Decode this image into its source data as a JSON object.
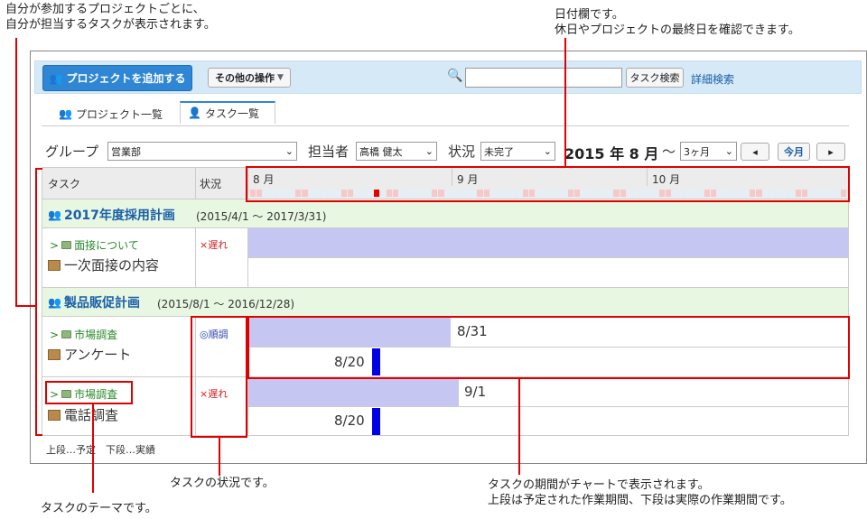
{
  "annotations": {
    "top_left_line1": "自分が参加するプロジェクトごとに、",
    "top_left_line2": "自分が担当するタスクが表示されます。",
    "top_right_line1": "日付欄です。",
    "top_right_line2": "休日やプロジェクトの最終日を確認できます。",
    "status_note": "タスクの状況です。",
    "theme_note": "タスクのテーマです。",
    "chart_note_line1": "タスクの期間がチャートで表示されます。",
    "chart_note_line2": "上段は予定された作業期間、下段は実際の作業期間です。"
  },
  "toolbar": {
    "add_project": "プロジェクトを追加する",
    "other_ops": "その他の操作",
    "search_value": "",
    "task_search": "タスク検索",
    "advanced_search": "詳細検索"
  },
  "tabs": [
    {
      "label": "プロジェクト一覧"
    },
    {
      "label": "タスク一覧"
    }
  ],
  "filters": {
    "group_label": "グループ",
    "group_value": "営業部",
    "assignee_label": "担当者",
    "assignee_value": "高橋 健太",
    "status_label": "状況",
    "status_value": "未完了",
    "date_display": "2015 年 8 月",
    "tilde": "～",
    "range_value": "3ヶ月",
    "prev": "◂",
    "today": "今月",
    "next": "▸"
  },
  "table": {
    "col_task": "タスク",
    "col_status": "状況",
    "months": [
      "8 月",
      "9 月",
      "10 月"
    ]
  },
  "projects": [
    {
      "title": "2017年度採用計画",
      "range": "(2015/4/1 ～ 2017/3/31)",
      "tasks": [
        {
          "theme": "面接について",
          "name": "一次面接の内容",
          "status": "×遅れ",
          "plan_label": "",
          "actual_label": ""
        }
      ]
    },
    {
      "title": "製品販促計画",
      "range": "(2015/8/1 ～ 2016/12/28)",
      "tasks": [
        {
          "theme": "市場調査",
          "name": "アンケート",
          "status": "◎順調",
          "plan_label": "8/31",
          "actual_label": "8/20"
        },
        {
          "theme": "市場調査",
          "name": "電話調査",
          "status": "×遅れ",
          "plan_label": "9/1",
          "actual_label": "8/20"
        }
      ]
    }
  ],
  "legend": "上段…予定　下段…実績",
  "theme_prefix": ">"
}
